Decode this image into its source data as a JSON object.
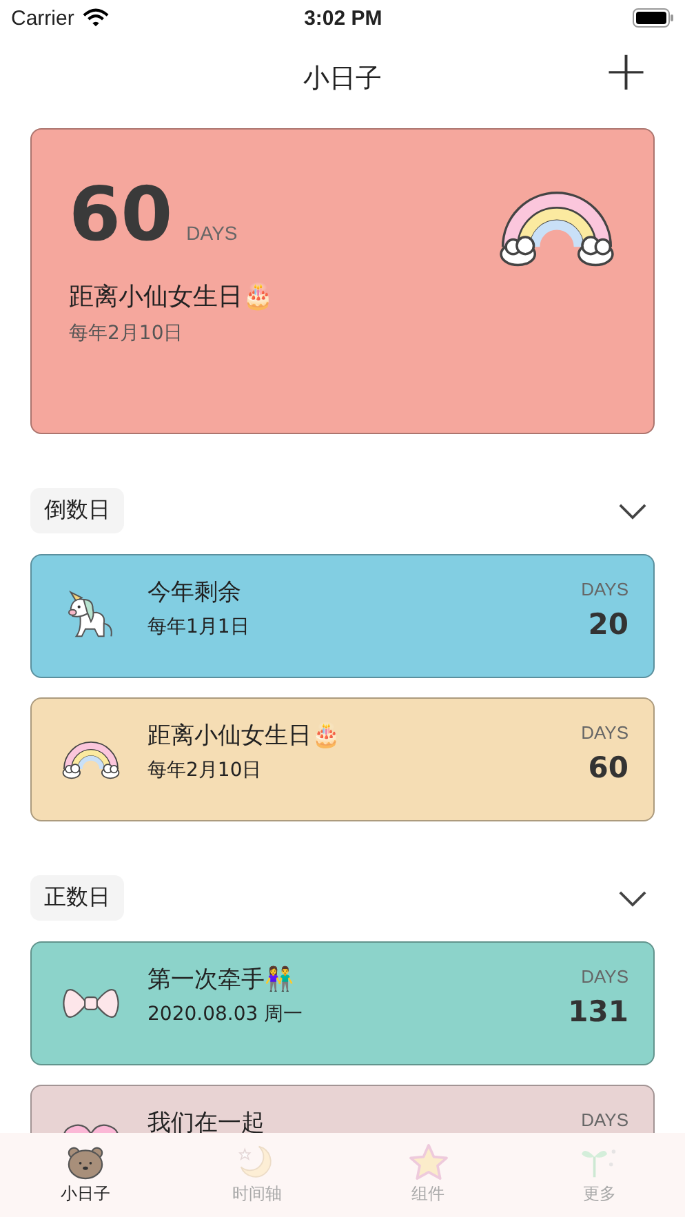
{
  "status_bar": {
    "carrier": "Carrier",
    "time": "3:02 PM"
  },
  "nav": {
    "title": "小日子",
    "add": "+"
  },
  "hero": {
    "number": "60",
    "unit": "DAYS",
    "title": "距离小仙女生日🎂",
    "subtitle": "每年2月10日",
    "kind": "rainbow",
    "color": "#f5a79d"
  },
  "sections": [
    {
      "label": "倒数日",
      "cards": [
        {
          "kind": "unicorn",
          "color": "#82cee2",
          "title": "今年剩余",
          "subtitle": "每年1月1日",
          "unit": "DAYS",
          "number": "20"
        },
        {
          "kind": "rainbow",
          "color": "#f5ddb4",
          "title": "距离小仙女生日🎂",
          "subtitle": "每年2月10日",
          "unit": "DAYS",
          "number": "60"
        }
      ]
    },
    {
      "label": "正数日",
      "cards": [
        {
          "kind": "bow",
          "color": "#8cd3ca",
          "title": "第一次牵手👫",
          "subtitle": "2020.08.03 周一",
          "unit": "DAYS",
          "number": "131"
        },
        {
          "kind": "heart",
          "color": "#e8d3d3",
          "title": "我们在一起",
          "unit": "DAYS"
        }
      ]
    }
  ],
  "tabs": [
    {
      "kind": "bear",
      "label": "小日子",
      "selected": true
    },
    {
      "kind": "moon",
      "label": "时间轴",
      "selected": false
    },
    {
      "kind": "star",
      "label": "组件",
      "selected": false
    },
    {
      "kind": "sprout",
      "label": "更多",
      "selected": false
    }
  ]
}
